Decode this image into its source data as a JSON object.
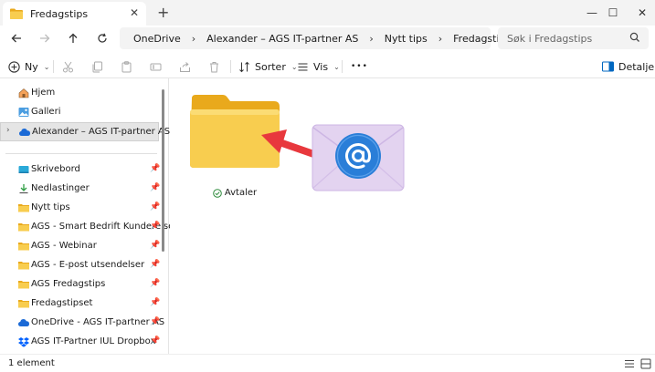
{
  "window": {
    "tab_title": "Fredagstips",
    "new_tab_label": "+",
    "minimize": "—",
    "maximize": "☐",
    "close": "✕"
  },
  "address": {
    "breadcrumbs": [
      "OneDrive",
      "Alexander – AGS IT-partner AS",
      "Nytt tips",
      "Fredagstips"
    ],
    "search_placeholder": "Søk i Fredagstips"
  },
  "toolbar": {
    "new_label": "Ny",
    "sort_label": "Sorter",
    "view_label": "Vis",
    "more_label": "•••",
    "details_label": "Detaljer"
  },
  "sidebar": {
    "items": [
      {
        "label": "Hjem",
        "icon": "home-icon"
      },
      {
        "label": "Galleri",
        "icon": "gallery-icon"
      },
      {
        "label": "Alexander – AGS IT-partner AS",
        "icon": "onedrive-cloud-icon"
      },
      {
        "label": "Skrivebord",
        "icon": "desktop-icon"
      },
      {
        "label": "Nedlastinger",
        "icon": "download-icon"
      },
      {
        "label": "Nytt tips",
        "icon": "folder-icon"
      },
      {
        "label": "AGS - Smart Bedrift Kundereisen",
        "icon": "folder-icon"
      },
      {
        "label": "AGS - Webinar",
        "icon": "folder-icon"
      },
      {
        "label": "AGS - E-post utsendelser",
        "icon": "folder-icon"
      },
      {
        "label": "AGS Fredagstips",
        "icon": "folder-icon"
      },
      {
        "label": "Fredagstipset",
        "icon": "folder-icon"
      },
      {
        "label": "OneDrive - AGS IT-partner AS",
        "icon": "onedrive-cloud-icon"
      },
      {
        "label": "AGS IT-Partner IUL Dropbox",
        "icon": "dropbox-icon"
      }
    ]
  },
  "content": {
    "folders": [
      {
        "name": "Avtaler",
        "status": "synced"
      }
    ]
  },
  "status": {
    "item_count": "1 element"
  },
  "colors": {
    "accent": "#0067c0",
    "folder": "#f8cd4f",
    "folder_back": "#e9a91c",
    "arrow": "#e8383d",
    "envelope": "#e3d3f0",
    "at_badge": "#2a7ed8",
    "sync_green": "#2e8b3c"
  }
}
